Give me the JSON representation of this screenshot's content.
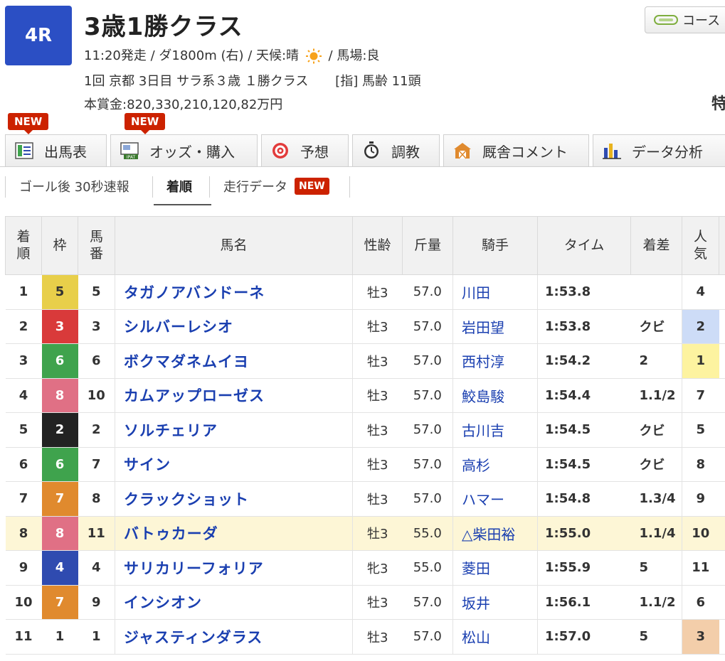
{
  "race": {
    "number": "4R",
    "title": "3歳1勝クラス",
    "info_before_icon": "11:20発走 / ダ1800m (右) / 天候:晴",
    "info_after_icon": "/ 馬場:良",
    "meeting": "1回 京都 3日目 サラ系３歳 １勝クラス",
    "conditions": "[指] 馬齢 11頭",
    "prize": "本賞金:820,330,210,120,82万円",
    "weather_icon": "sun-icon",
    "course_button": "コース",
    "special_label": "特"
  },
  "tabs": [
    {
      "label": "出馬表",
      "icon": "entry-sheet-icon",
      "new": "NEW"
    },
    {
      "label": "オッズ・購入",
      "icon": "ipat-odds-icon",
      "new": "NEW"
    },
    {
      "label": "予想",
      "icon": "target-icon",
      "new": ""
    },
    {
      "label": "調教",
      "icon": "stopwatch-icon",
      "new": ""
    },
    {
      "label": "厩舎コメント",
      "icon": "stable-icon",
      "new": ""
    },
    {
      "label": "データ分析",
      "icon": "bar-chart-icon",
      "new": ""
    }
  ],
  "subtabs": {
    "goal_report": "ゴール後 30秒速報",
    "result": "着順",
    "running_data": "走行データ",
    "running_data_new": "NEW"
  },
  "table": {
    "headers": {
      "rank": "着順",
      "waku": "枠",
      "umaban": "馬番",
      "horse": "馬名",
      "sex_age": "性齢",
      "weight": "斤量",
      "jockey": "騎手",
      "time": "タイム",
      "margin": "着差",
      "popularity": "人気"
    },
    "rows": [
      {
        "rank": "1",
        "waku": "5",
        "umaban": "5",
        "horse": "タガノアバンドーネ",
        "sex_age": "牡3",
        "weight": "57.0",
        "jockey": "川田",
        "time": "1:53.8",
        "margin": "",
        "pop": "4"
      },
      {
        "rank": "2",
        "waku": "3",
        "umaban": "3",
        "horse": "シルバーレシオ",
        "sex_age": "牡3",
        "weight": "57.0",
        "jockey": "岩田望",
        "time": "1:53.8",
        "margin": "クビ",
        "pop": "2"
      },
      {
        "rank": "3",
        "waku": "6",
        "umaban": "6",
        "horse": "ボクマダネムイヨ",
        "sex_age": "牡3",
        "weight": "57.0",
        "jockey": "西村淳",
        "time": "1:54.2",
        "margin": "2",
        "pop": "1"
      },
      {
        "rank": "4",
        "waku": "8",
        "umaban": "10",
        "horse": "カムアップローゼス",
        "sex_age": "牡3",
        "weight": "57.0",
        "jockey": "鮫島駿",
        "time": "1:54.4",
        "margin": "1.1/2",
        "pop": "7"
      },
      {
        "rank": "5",
        "waku": "2",
        "umaban": "2",
        "horse": "ソルチェリア",
        "sex_age": "牡3",
        "weight": "57.0",
        "jockey": "古川吉",
        "time": "1:54.5",
        "margin": "クビ",
        "pop": "5"
      },
      {
        "rank": "6",
        "waku": "6",
        "umaban": "7",
        "horse": "サイン",
        "sex_age": "牡3",
        "weight": "57.0",
        "jockey": "高杉",
        "time": "1:54.5",
        "margin": "クビ",
        "pop": "8"
      },
      {
        "rank": "7",
        "waku": "7",
        "umaban": "8",
        "horse": "クラックショット",
        "sex_age": "牡3",
        "weight": "57.0",
        "jockey": "ハマー",
        "time": "1:54.8",
        "margin": "1.3/4",
        "pop": "9"
      },
      {
        "rank": "8",
        "waku": "8",
        "umaban": "11",
        "horse": "バトゥカーダ",
        "sex_age": "牡3",
        "weight": "55.0",
        "jockey": "△柴田裕",
        "time": "1:55.0",
        "margin": "1.1/4",
        "pop": "10"
      },
      {
        "rank": "9",
        "waku": "4",
        "umaban": "4",
        "horse": "サリカリーフォリア",
        "sex_age": "牝3",
        "weight": "55.0",
        "jockey": "菱田",
        "time": "1:55.9",
        "margin": "5",
        "pop": "11"
      },
      {
        "rank": "10",
        "waku": "7",
        "umaban": "9",
        "horse": "インシオン",
        "sex_age": "牡3",
        "weight": "57.0",
        "jockey": "坂井",
        "time": "1:56.1",
        "margin": "1.1/2",
        "pop": "6"
      },
      {
        "rank": "11",
        "waku": "1",
        "umaban": "1",
        "horse": "ジャスティンダラス",
        "sex_age": "牡3",
        "weight": "57.0",
        "jockey": "松山",
        "time": "1:57.0",
        "margin": "5",
        "pop": "3"
      }
    ]
  },
  "colors": {
    "race_badge": "#2b4fc4",
    "link": "#1a3fb0",
    "new_badge": "#cc2200",
    "highlight_row": "#fdf6d6",
    "waku": {
      "1": "#ffffff",
      "2": "#222222",
      "3": "#d93a3a",
      "4": "#2f4bb0",
      "5": "#e8cf4a",
      "6": "#3fa34d",
      "7": "#e08a2e",
      "8": "#e07085"
    },
    "popularity": {
      "1": "#fdf3a0",
      "2": "#cddcf7",
      "3": "#f3ceaa"
    }
  }
}
